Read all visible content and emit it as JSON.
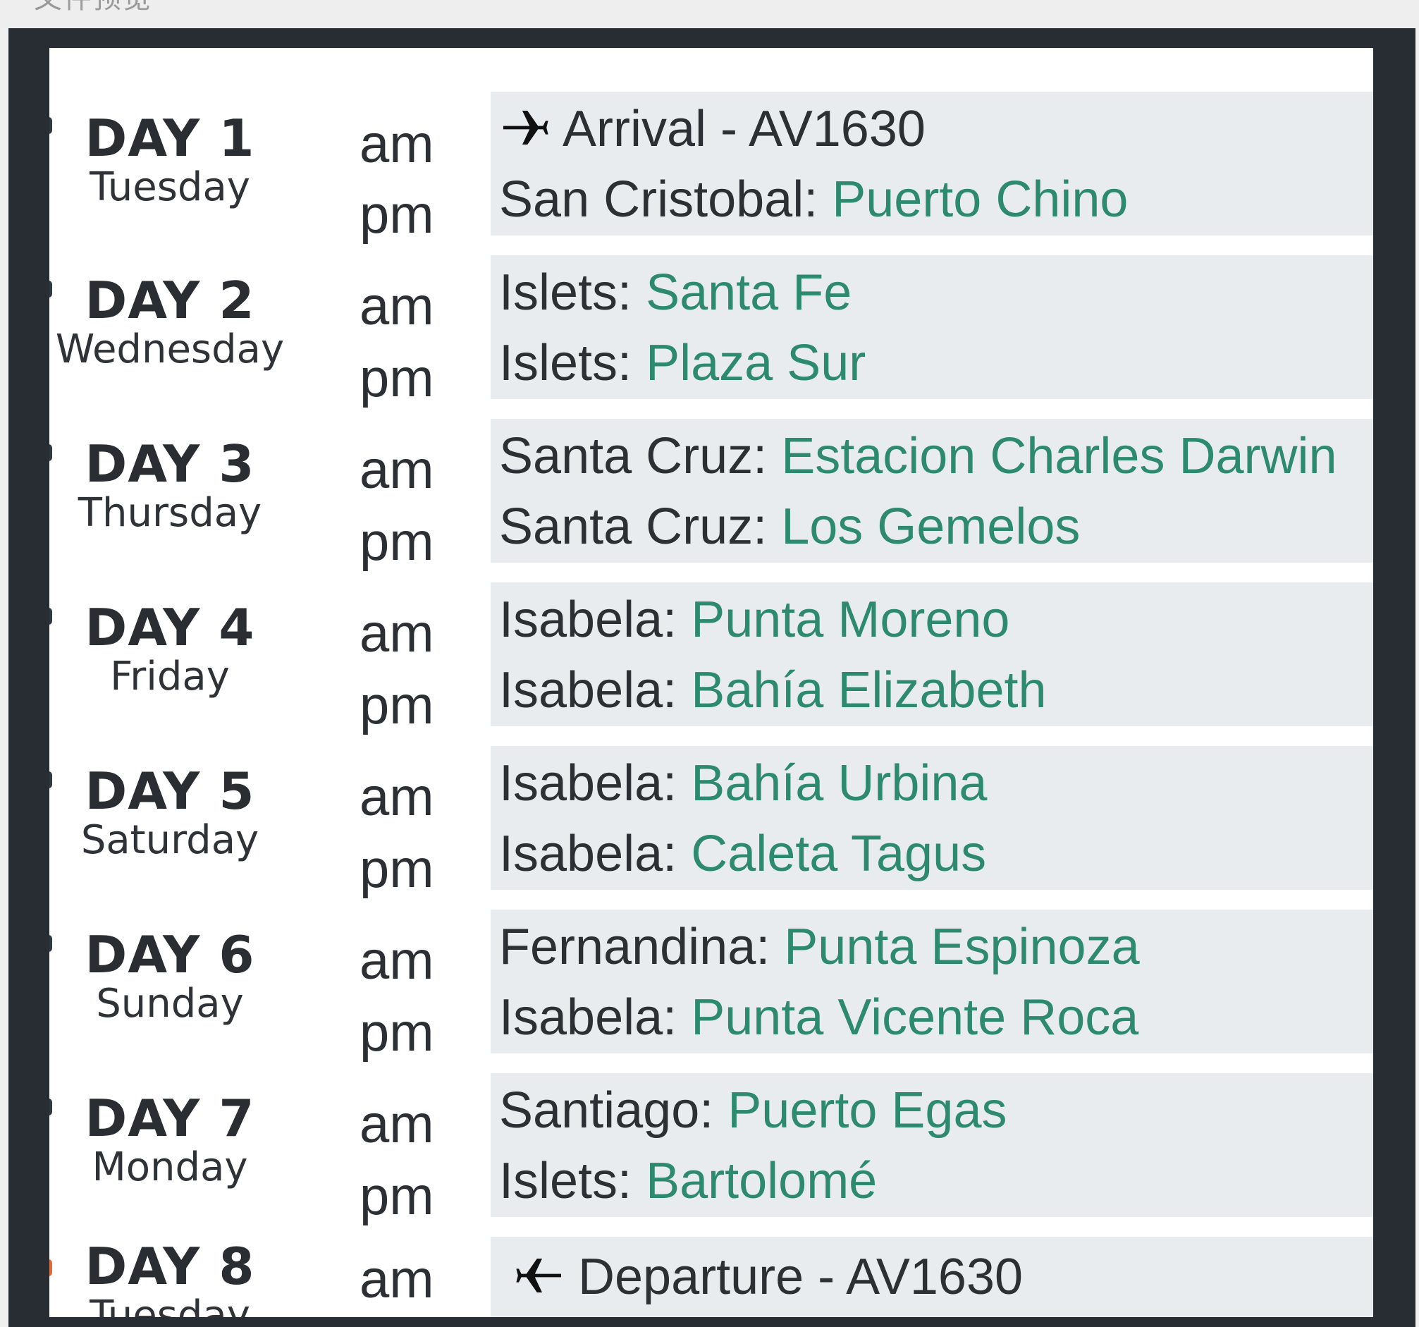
{
  "window": {
    "title": "文件预览"
  },
  "colors": {
    "accent_green": "#2e8a6e",
    "card_bg": "#e9ecef",
    "frame": "#282d33"
  },
  "itinerary": {
    "days": [
      {
        "day": "DAY 1",
        "weekday": "Tuesday",
        "am": {
          "label": "am",
          "prefix": "Arrival - AV1630",
          "place": "",
          "icon": "plane-arrival-icon"
        },
        "pm": {
          "label": "pm",
          "prefix": "San Cristobal: ",
          "place": "Puerto Chino"
        }
      },
      {
        "day": "DAY 2",
        "weekday": "Wednesday",
        "am": {
          "label": "am",
          "prefix": "Islets: ",
          "place": "Santa Fe"
        },
        "pm": {
          "label": "pm",
          "prefix": "Islets: ",
          "place": "Plaza Sur"
        }
      },
      {
        "day": "DAY 3",
        "weekday": "Thursday",
        "am": {
          "label": "am",
          "prefix": "Santa Cruz: ",
          "place": "Estacion Charles Darwin"
        },
        "pm": {
          "label": "pm",
          "prefix": "Santa Cruz: ",
          "place": "Los Gemelos"
        }
      },
      {
        "day": "DAY 4",
        "weekday": "Friday",
        "am": {
          "label": "am",
          "prefix": "Isabela: ",
          "place": "Punta Moreno"
        },
        "pm": {
          "label": "pm",
          "prefix": "Isabela: ",
          "place": "Bahía Elizabeth"
        }
      },
      {
        "day": "DAY 5",
        "weekday": "Saturday",
        "am": {
          "label": "am",
          "prefix": "Isabela: ",
          "place": "Bahía Urbina"
        },
        "pm": {
          "label": "pm",
          "prefix": "Isabela: ",
          "place": "Caleta Tagus"
        }
      },
      {
        "day": "DAY 6",
        "weekday": "Sunday",
        "am": {
          "label": "am",
          "prefix": "Fernandina: ",
          "place": "Punta Espinoza"
        },
        "pm": {
          "label": "pm",
          "prefix": "Isabela: ",
          "place": "Punta Vicente Roca"
        }
      },
      {
        "day": "DAY 7",
        "weekday": "Monday",
        "am": {
          "label": "am",
          "prefix": "Santiago: ",
          "place": "Puerto Egas"
        },
        "pm": {
          "label": "pm",
          "prefix": "Islets: ",
          "place": "Bartolomé"
        }
      },
      {
        "day": "DAY 8",
        "weekday": "Tuesday",
        "am": {
          "label": "am",
          "prefix": "Departure - AV1630",
          "place": "",
          "icon": "plane-departure-icon"
        }
      }
    ]
  }
}
